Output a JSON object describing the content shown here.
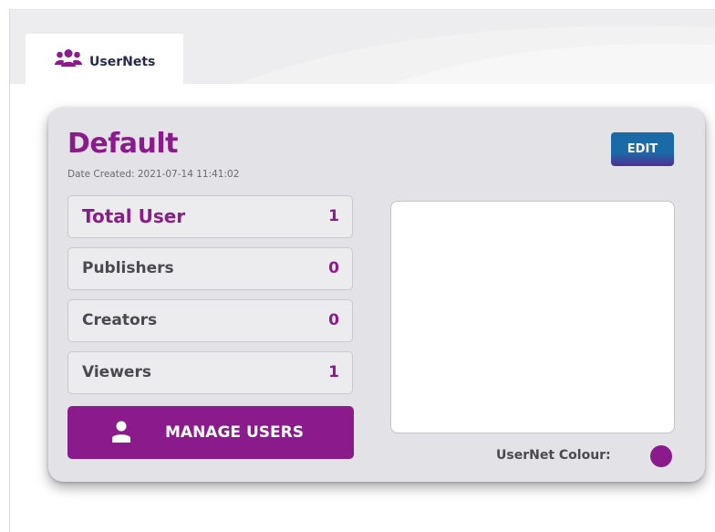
{
  "tabs": [
    {
      "label": "UserNets",
      "icon": "users-group-icon"
    }
  ],
  "usernet": {
    "name": "Default",
    "date_created": "Date Created: 2021-07-14 11:41:02",
    "edit_label": "EDIT",
    "stats": [
      {
        "label": "Total User",
        "value": "1"
      },
      {
        "label": "Publishers",
        "value": "0"
      },
      {
        "label": "Creators",
        "value": "0"
      },
      {
        "label": "Viewers",
        "value": "1"
      }
    ],
    "manage_label": "MANAGE USERS",
    "manage_icon": "user-icon",
    "colour_label": "UserNet Colour:",
    "colour": "#8b1b8d"
  },
  "colors": {
    "accent": "#8b1b8d",
    "edit_button": "#1a6aa8",
    "tab_text": "#262a4d"
  }
}
